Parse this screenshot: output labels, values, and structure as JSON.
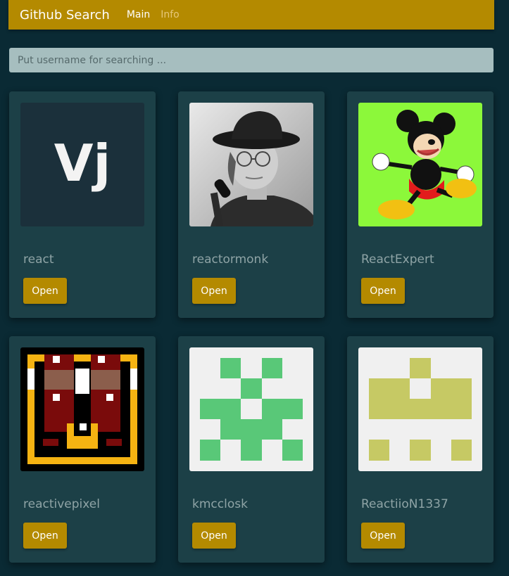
{
  "nav": {
    "brand": "Github Search",
    "links": [
      {
        "label": "Main",
        "active": true
      },
      {
        "label": "Info",
        "active": false
      }
    ]
  },
  "search": {
    "placeholder": "Put username for searching ...",
    "value": ""
  },
  "users": [
    {
      "login": "react",
      "button": "Open",
      "avatar": "vj-logo",
      "avatar_text": "Vj"
    },
    {
      "login": "reactormonk",
      "button": "Open",
      "avatar": "photo-man-with-hat"
    },
    {
      "login": "ReactExpert",
      "button": "Open",
      "avatar": "mickey-mouse"
    },
    {
      "login": "reactivepixel",
      "button": "Open",
      "avatar": "pixel-art"
    },
    {
      "login": "kmcclosk",
      "button": "Open",
      "avatar": "identicon-green"
    },
    {
      "login": "ReactiioN1337",
      "button": "Open",
      "avatar": "identicon-olive"
    }
  ],
  "colors": {
    "accent": "#b48a00",
    "background": "#0a2a34",
    "card": "#1c4047",
    "identicon_green": "#59c878",
    "identicon_olive": "#c6c964"
  }
}
